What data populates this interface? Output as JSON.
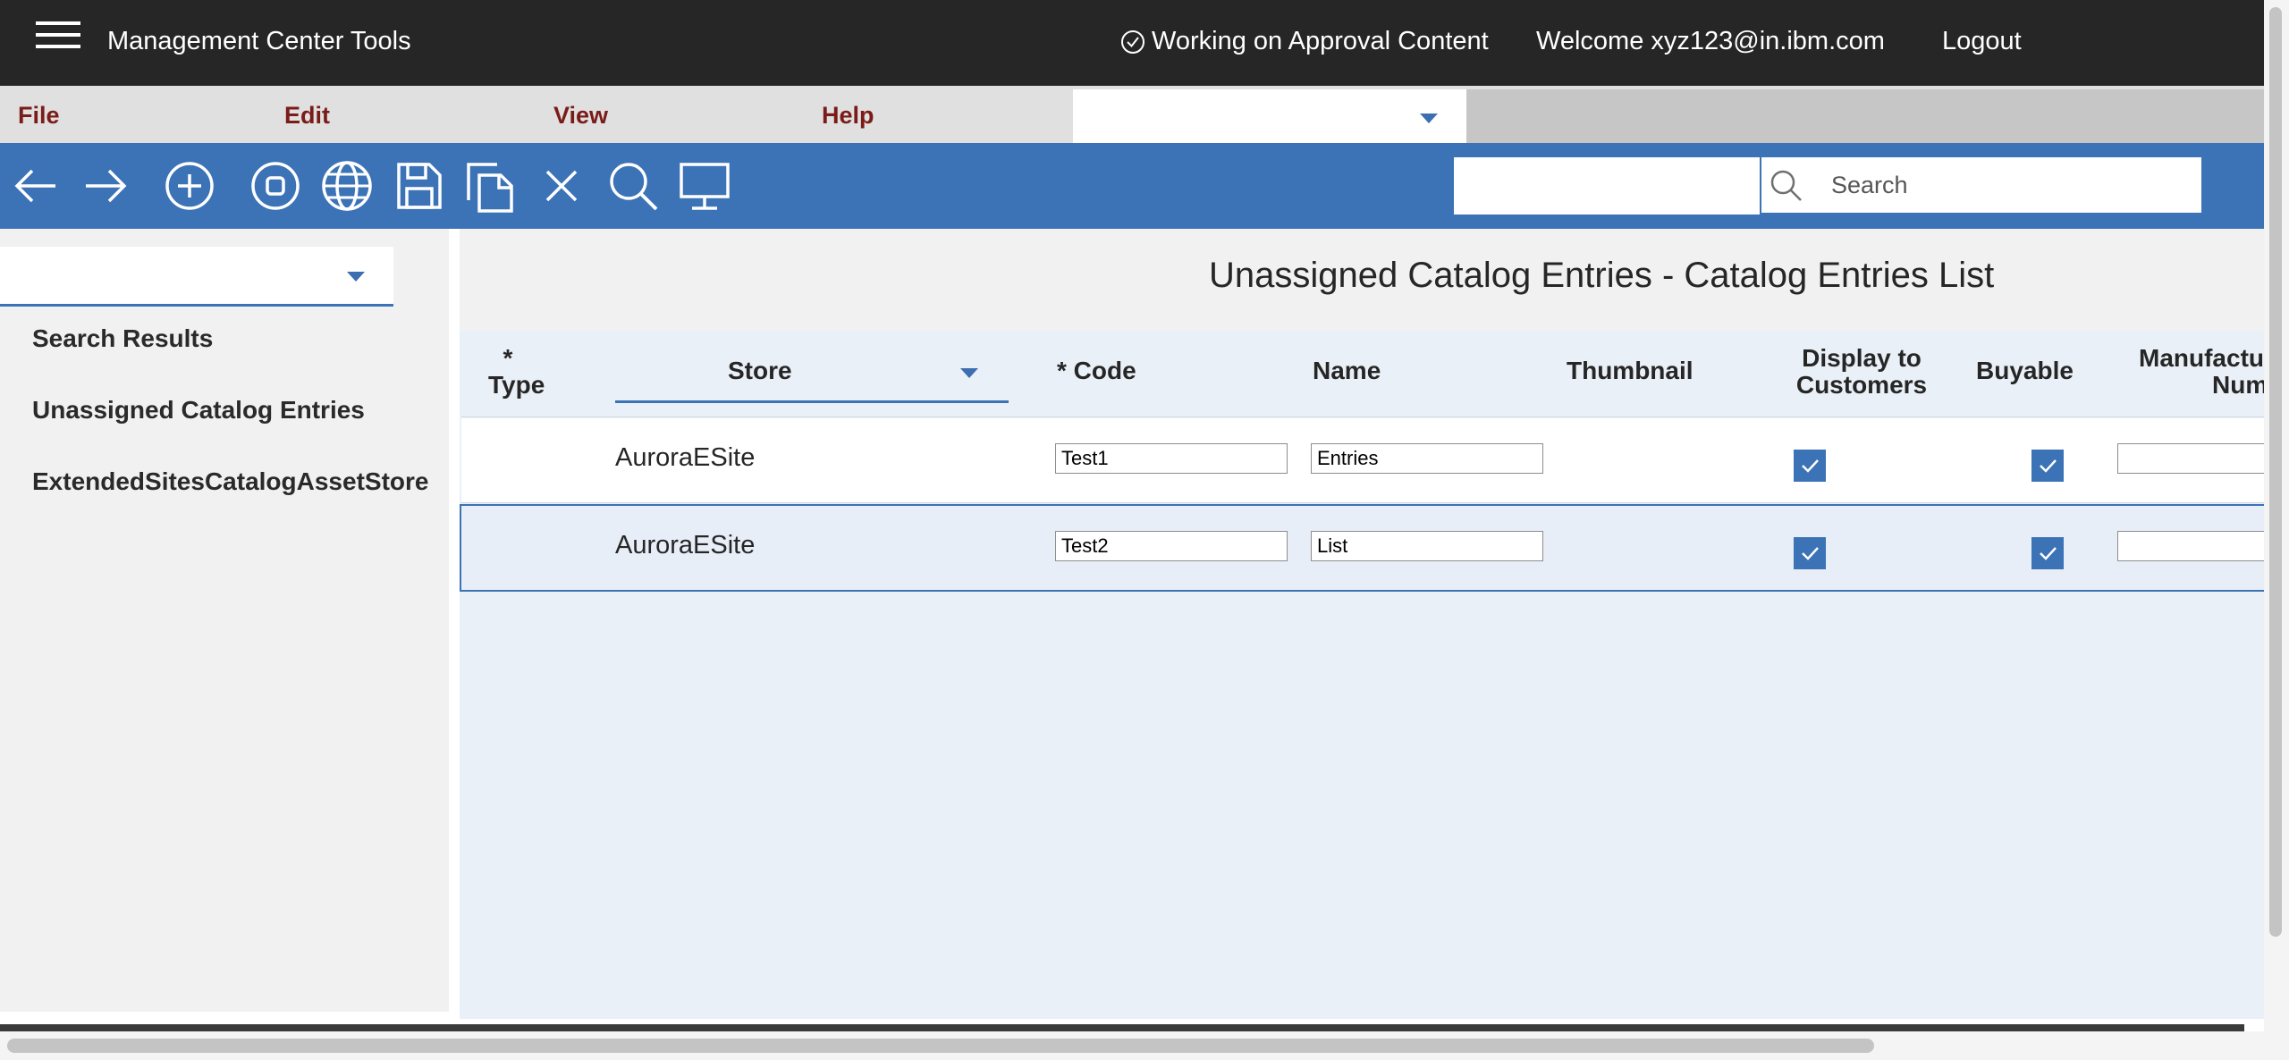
{
  "header": {
    "app_title": "Management Center Tools",
    "approval_status": "Working on Approval Content",
    "welcome": "Welcome xyz123@in.ibm.com",
    "logout_label": "Logout"
  },
  "menubar": {
    "items": [
      "File",
      "Edit",
      "View",
      "Help"
    ],
    "tool_selector_value": ""
  },
  "toolbar": {
    "icons": [
      "back-arrow-icon",
      "forward-arrow-icon",
      "add-circle-icon",
      "stop-circle-icon",
      "globe-icon",
      "save-icon",
      "copy-icon",
      "close-icon",
      "search-icon",
      "monitor-icon"
    ],
    "find_value": "",
    "search_placeholder": "Search"
  },
  "left_panel": {
    "selector_value": "",
    "items": [
      "Search Results",
      "Unassigned Catalog Entries",
      "ExtendedSitesCatalogAssetStore"
    ]
  },
  "main": {
    "title": "Unassigned Catalog Entries - Catalog Entries List",
    "columns": {
      "type": "* Type",
      "type_star": "*",
      "type_label": "Type",
      "store": "Store",
      "code": "* Code",
      "name": "Name",
      "thumbnail": "Thumbnail",
      "display_line1": "Display to",
      "display_line2": "Customers",
      "buyable": "Buyable",
      "manuf_line1": "Manufactu",
      "manuf_line2": "Numb"
    },
    "rows": [
      {
        "store": "AuroraESite",
        "code": "Test1",
        "name": "Entries",
        "display_to_customers": true,
        "buyable": true,
        "manufacturer_number": ""
      },
      {
        "store": "AuroraESite",
        "code": "Test2",
        "name": "List",
        "display_to_customers": true,
        "buyable": true,
        "manufacturer_number": ""
      }
    ]
  },
  "colors": {
    "topbar": "#262626",
    "toolbar": "#3c72b6",
    "menu_text": "#7a1c18",
    "selected_row": "#e8eef7"
  }
}
